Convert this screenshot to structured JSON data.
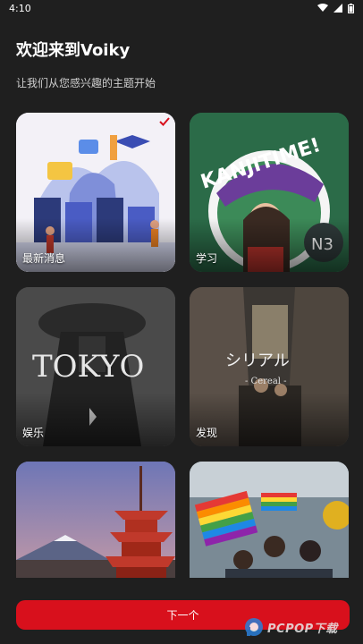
{
  "status_bar": {
    "time": "4:10",
    "icons": [
      "wifi-icon",
      "signal-icon",
      "battery-icon"
    ]
  },
  "header": {
    "title": "欢迎来到Voiky",
    "subtitle": "让我们从您感兴趣的主题开始"
  },
  "topics": [
    {
      "label": "最新消息",
      "selected": true,
      "image_text": ""
    },
    {
      "label": "学习",
      "selected": false,
      "image_text": "KANJITIME!"
    },
    {
      "label": "娱乐",
      "selected": false,
      "image_text": "TOKYO"
    },
    {
      "label": "发现",
      "selected": false,
      "image_text": "シリアル"
    },
    {
      "label": "",
      "selected": false,
      "image_text": ""
    },
    {
      "label": "",
      "selected": false,
      "image_text": ""
    }
  ],
  "footer": {
    "next_label": "下一个"
  },
  "watermark": {
    "text": "PCPOP下载"
  },
  "colors": {
    "background": "#1f1f1f",
    "accent": "#d8101c"
  }
}
